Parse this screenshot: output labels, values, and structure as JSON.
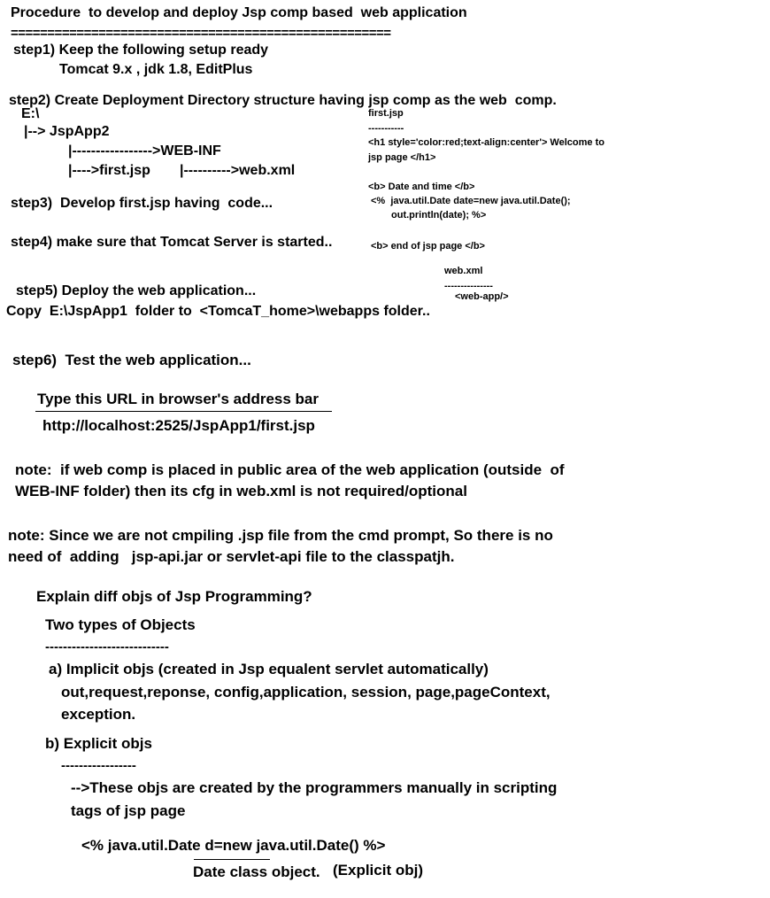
{
  "title": "Procedure  to develop and deploy Jsp comp based  web application",
  "separator": "====================================================",
  "step1": {
    "label": "step1) Keep the following setup ready",
    "detail": "Tomcat 9.x , jdk 1.8, EditPlus"
  },
  "step2": {
    "label": "step2) Create Deployment Directory structure having jsp comp as the web  comp.",
    "tree": {
      "root": "E:\\",
      "app": "|--> JspApp2",
      "webinf": "|----------------->WEB-INF",
      "first": "|---->first.jsp",
      "webxml": "|---------->web.xml"
    }
  },
  "step3": "step3)  Develop first.jsp having  code...",
  "step4": "step4) make sure that Tomcat Server is started..",
  "side_code": {
    "first_title": "first.jsp",
    "first_dashes": "-----------",
    "h1_line1": "<h1 style='color:red;text-align:center'> Welcome to",
    "h1_line2": "jsp page </h1>",
    "b_line": "<b> Date and time </b>",
    "scriptlet1": "<%  java.util.Date date=new java.util.Date();",
    "scriptlet2": "out.println(date); %>",
    "end_line": "<b> end of jsp page </b>",
    "webxml_title": "web.xml",
    "webxml_dashes": "---------------",
    "webapp": "<web-app/>"
  },
  "step5": {
    "label": "step5) Deploy the web application...",
    "detail": "Copy  E:\\JspApp1  folder to  <TomcaT_home>\\webapps folder.."
  },
  "step6": {
    "label": "step6)  Test the web application...",
    "url_hint": "Type this URL in browser's address bar",
    "url": "http://localhost:2525/JspApp1/first.jsp"
  },
  "note1": {
    "line1": "note:  if web comp is placed in public area of the web application (outside  of",
    "line2": "WEB-INF folder) then its cfg in web.xml is not required/optional"
  },
  "note2": {
    "line1": "note: Since we are not cmpiling .jsp file from the cmd prompt, So there is no",
    "line2": "need of  adding   jsp-api.jar or servlet-api file to the classpatjh."
  },
  "objects": {
    "question": "Explain diff objs of Jsp Programming?",
    "types": "Two types of Objects",
    "types_dashes": "----------------------------",
    "implicit_title": "a) Implicit objs (created in Jsp equalent servlet automatically)",
    "implicit_list1": "out,request,reponse, config,application, session, page,pageContext,",
    "implicit_list2": "exception.",
    "explicit_title": "b) Explicit objs",
    "explicit_dashes": "-----------------",
    "explicit_desc1": "-->These objs are created by the programmers manually in scripting",
    "explicit_desc2": "tags of jsp page",
    "code": "<% java.util.Date d=new java.util.Date() %>",
    "date_class": "Date class",
    "object_word": " object.",
    "explicit_note": "(Explicit obj)"
  }
}
